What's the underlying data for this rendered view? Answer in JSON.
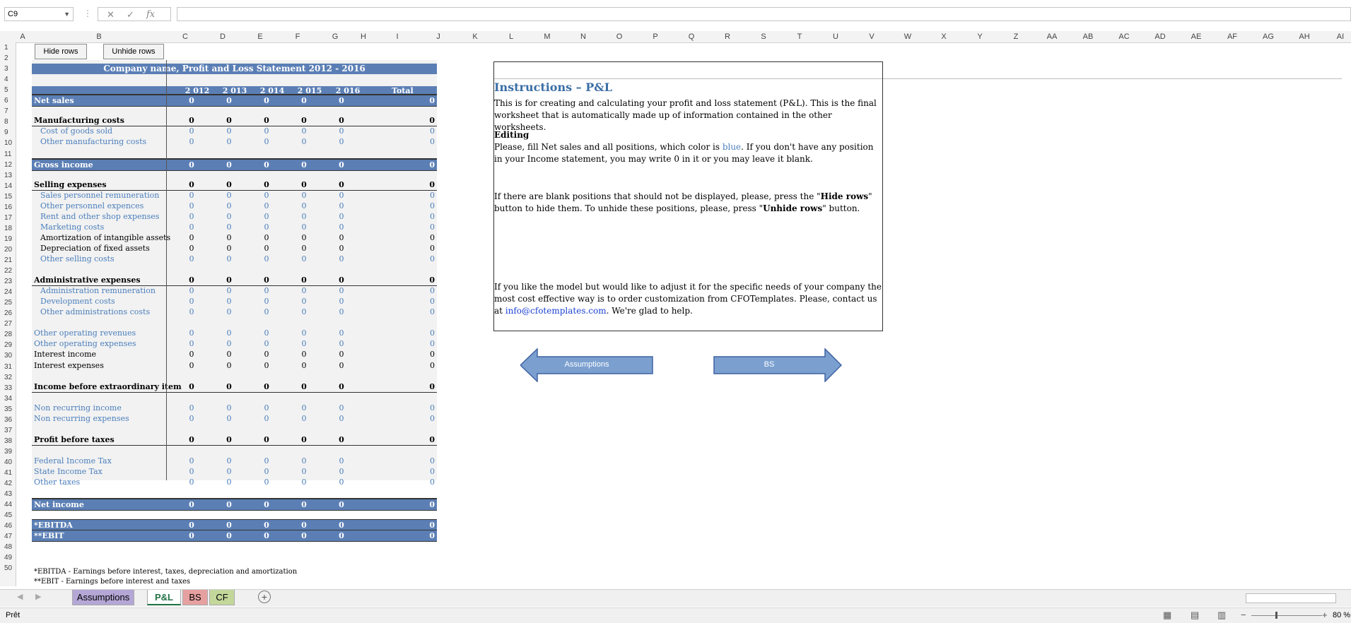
{
  "formula_bar": {
    "name_box": "C9",
    "formula": ""
  },
  "columns": [
    "A",
    "B",
    "C",
    "D",
    "E",
    "F",
    "G",
    "H",
    "I",
    "J",
    "K",
    "L",
    "M",
    "N",
    "O",
    "P",
    "Q",
    "R",
    "S",
    "T",
    "U",
    "V",
    "W",
    "X",
    "Y",
    "Z",
    "AA",
    "AB",
    "AC",
    "AD",
    "AE",
    "AF",
    "AG",
    "AH",
    "AI"
  ],
  "rows": [
    "1",
    "2",
    "3",
    "4",
    "5",
    "6",
    "7",
    "8",
    "9",
    "10",
    "11",
    "12",
    "13",
    "14",
    "15",
    "16",
    "17",
    "18",
    "19",
    "20",
    "21",
    "22",
    "23",
    "24",
    "25",
    "26",
    "27",
    "28",
    "29",
    "30",
    "31",
    "32",
    "33",
    "34",
    "35",
    "36",
    "37",
    "38",
    "39",
    "40",
    "41",
    "42",
    "43",
    "44",
    "45",
    "46",
    "47",
    "48",
    "49",
    "50"
  ],
  "buttons": {
    "hide": "Hide rows",
    "unhide": "Unhide rows"
  },
  "title": "Company name, Profit and Loss Statement 2012 - 2016",
  "years": [
    "2 012",
    "2 013",
    "2 014",
    "2 015",
    "2 016"
  ],
  "total_label": "Total",
  "lines": [
    {
      "label": "Net sales",
      "style": "band",
      "values": [
        "0",
        "0",
        "0",
        "0",
        "0"
      ],
      "total": "0"
    },
    {
      "label": "Manufacturing costs",
      "style": "bold",
      "values": [
        "0",
        "0",
        "0",
        "0",
        "0"
      ],
      "total": "0"
    },
    {
      "label": "Cost of goods sold",
      "style": "blue indent",
      "values": [
        "0",
        "0",
        "0",
        "0",
        "0"
      ],
      "total": "0"
    },
    {
      "label": "Other manufacturing costs",
      "style": "blue indent",
      "values": [
        "0",
        "0",
        "0",
        "0",
        "0"
      ],
      "total": "0"
    },
    {
      "label": "Gross income",
      "style": "band",
      "values": [
        "0",
        "0",
        "0",
        "0",
        "0"
      ],
      "total": "0"
    },
    {
      "label": "Selling expenses",
      "style": "bold",
      "values": [
        "0",
        "0",
        "0",
        "0",
        "0"
      ],
      "total": "0"
    },
    {
      "label": "Sales personnel remuneration",
      "style": "blue indent",
      "values": [
        "0",
        "0",
        "0",
        "0",
        "0"
      ],
      "total": "0"
    },
    {
      "label": "Other personnel expences",
      "style": "blue indent",
      "values": [
        "0",
        "0",
        "0",
        "0",
        "0"
      ],
      "total": "0"
    },
    {
      "label": "Rent and other shop expenses",
      "style": "blue indent",
      "values": [
        "0",
        "0",
        "0",
        "0",
        "0"
      ],
      "total": "0"
    },
    {
      "label": "Marketing costs",
      "style": "blue indent",
      "values": [
        "0",
        "0",
        "0",
        "0",
        "0"
      ],
      "total": "0"
    },
    {
      "label": "Amortization of intangible assets",
      "style": "indent",
      "values": [
        "0",
        "0",
        "0",
        "0",
        "0"
      ],
      "total": "0"
    },
    {
      "label": "Depreciation of fixed assets",
      "style": "indent",
      "values": [
        "0",
        "0",
        "0",
        "0",
        "0"
      ],
      "total": "0"
    },
    {
      "label": "Other selling costs",
      "style": "blue indent",
      "values": [
        "0",
        "0",
        "0",
        "0",
        "0"
      ],
      "total": "0"
    },
    {
      "label": "Administrative expenses",
      "style": "bold",
      "values": [
        "0",
        "0",
        "0",
        "0",
        "0"
      ],
      "total": "0"
    },
    {
      "label": "Administration remuneration",
      "style": "blue indent",
      "values": [
        "0",
        "0",
        "0",
        "0",
        "0"
      ],
      "total": "0"
    },
    {
      "label": "Development costs",
      "style": "blue indent",
      "values": [
        "0",
        "0",
        "0",
        "0",
        "0"
      ],
      "total": "0"
    },
    {
      "label": "Other administrations costs",
      "style": "blue indent",
      "values": [
        "0",
        "0",
        "0",
        "0",
        "0"
      ],
      "total": "0"
    },
    {
      "label": "Other operating revenues",
      "style": "blue",
      "values": [
        "0",
        "0",
        "0",
        "0",
        "0"
      ],
      "total": "0"
    },
    {
      "label": "Other operating expenses",
      "style": "blue",
      "values": [
        "0",
        "0",
        "0",
        "0",
        "0"
      ],
      "total": "0"
    },
    {
      "label": "Interest income",
      "style": "",
      "values": [
        "0",
        "0",
        "0",
        "0",
        "0"
      ],
      "total": "0"
    },
    {
      "label": "Interest expenses",
      "style": "",
      "values": [
        "0",
        "0",
        "0",
        "0",
        "0"
      ],
      "total": "0"
    },
    {
      "label": "Income before extraordinary item",
      "style": "bold",
      "values": [
        "0",
        "0",
        "0",
        "0",
        "0"
      ],
      "total": "0"
    },
    {
      "label": "Non recurring income",
      "style": "blue",
      "values": [
        "0",
        "0",
        "0",
        "0",
        "0"
      ],
      "total": "0"
    },
    {
      "label": "Non recurring expenses",
      "style": "blue",
      "values": [
        "0",
        "0",
        "0",
        "0",
        "0"
      ],
      "total": "0"
    },
    {
      "label": "Profit before taxes",
      "style": "bold",
      "values": [
        "0",
        "0",
        "0",
        "0",
        "0"
      ],
      "total": "0"
    },
    {
      "label": "Federal Income Tax",
      "style": "blue",
      "values": [
        "0",
        "0",
        "0",
        "0",
        "0"
      ],
      "total": "0"
    },
    {
      "label": "State Income Tax",
      "style": "blue",
      "values": [
        "0",
        "0",
        "0",
        "0",
        "0"
      ],
      "total": "0"
    },
    {
      "label": "Other taxes",
      "style": "blue",
      "values": [
        "0",
        "0",
        "0",
        "0",
        "0"
      ],
      "total": "0"
    },
    {
      "label": "Net income",
      "style": "band",
      "values": [
        "0",
        "0",
        "0",
        "0",
        "0"
      ],
      "total": "0"
    },
    {
      "label": "*EBITDA",
      "style": "band soft",
      "values": [
        "0",
        "0",
        "0",
        "0",
        "0"
      ],
      "total": "0"
    },
    {
      "label": "**EBIT",
      "style": "band soft",
      "values": [
        "0",
        "0",
        "0",
        "0",
        "0"
      ],
      "total": "0"
    }
  ],
  "footnotes": [
    "*EBITDA - Earnings before interest, taxes, depreciation and amortization",
    "**EBIT - Earnings before interest and taxes"
  ],
  "instructions": {
    "heading": "Instructions – P&L",
    "p1": "This is for creating and calculating your profit and loss statement (P&L). This is the final worksheet that is automatically made up of information contained in the other worksheets.",
    "editing": "Editing",
    "p2a": "Please, fill Net sales and all positions, which color is ",
    "p2blue": "blue",
    "p2b": ".  If you don't have any position in your Income statement, you may write 0 in it or you may leave it blank.",
    "p3a": "If there are blank positions that should not be displayed, please, press the \"",
    "p3b1": "Hide rows",
    "p3c": "\" button to hide them. To unhide these positions, please, press \"",
    "p3b2": "Unhide rows",
    "p3d": "\" button.",
    "p4a": "If you like the model but would like to adjust it for the specific needs of your company the most cost effective way is to order customization from CFOTemplates. Please, contact us at ",
    "email": "info@cfotemplates.com",
    "p4b": ". We're glad to help."
  },
  "nav": {
    "back": "Assumptions",
    "forward": "BS"
  },
  "sheet_tabs": [
    {
      "name": "Assumptions",
      "color": "#b4a7d6",
      "active": false
    },
    {
      "name": "P&L",
      "color": "#ffffff",
      "active": true
    },
    {
      "name": "BS",
      "color": "#e6a0a0",
      "active": false
    },
    {
      "name": "CF",
      "color": "#c4d79b",
      "active": false
    }
  ],
  "status": {
    "text": "Prêt",
    "zoom": "80 %"
  }
}
